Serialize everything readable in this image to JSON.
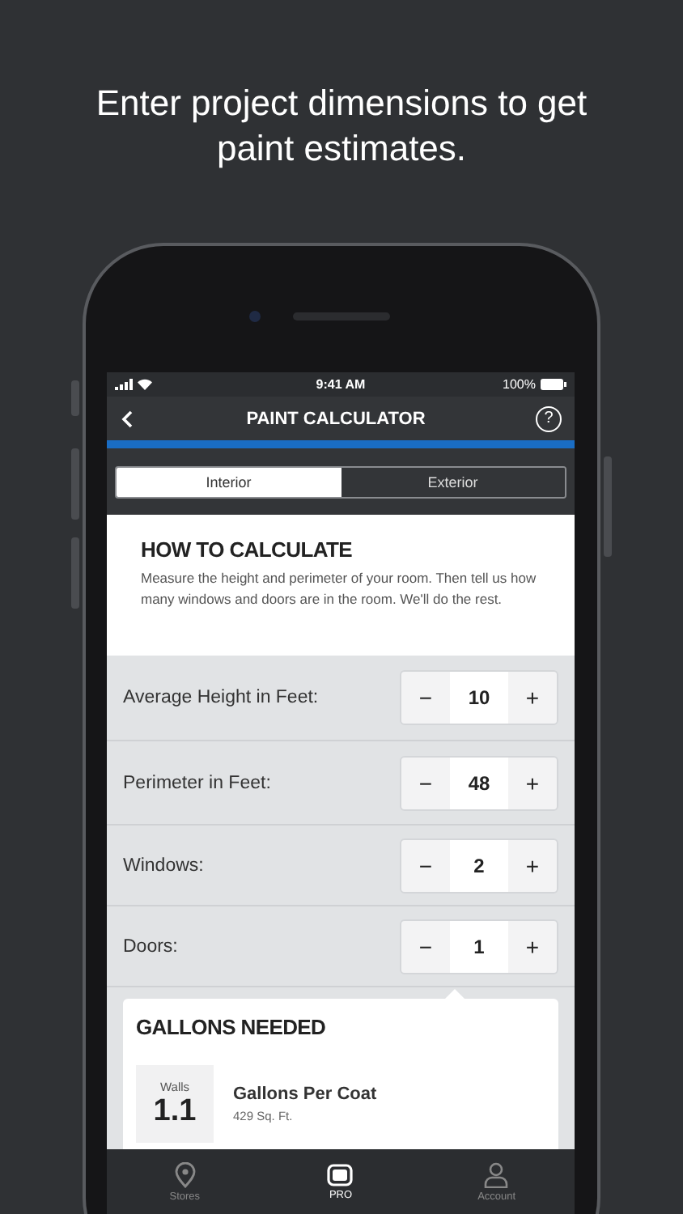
{
  "headline": "Enter project dimensions to get paint estimates.",
  "status_bar": {
    "time": "9:41 AM",
    "battery": "100%"
  },
  "nav": {
    "title": "PAINT CALCULATOR",
    "help": "?"
  },
  "tabs": [
    {
      "label": "Interior",
      "selected": true
    },
    {
      "label": "Exterior",
      "selected": false
    }
  ],
  "how_to": {
    "title": "HOW TO CALCULATE",
    "text": "Measure the height and perimeter of your room. Then tell us how many windows and doors are in the room. We'll do the rest."
  },
  "inputs": [
    {
      "label": "Average Height in Feet:",
      "value": "10",
      "decrement": "−",
      "increment": "+"
    },
    {
      "label": "Perimeter in Feet:",
      "value": "48",
      "decrement": "−",
      "increment": "+"
    },
    {
      "label": "Windows:",
      "value": "2",
      "decrement": "−",
      "increment": "+"
    },
    {
      "label": "Doors:",
      "value": "1",
      "decrement": "−",
      "increment": "+"
    }
  ],
  "result": {
    "title": "GALLONS NEEDED",
    "items": [
      {
        "label": "Walls",
        "value": "1.1",
        "title": "Gallons Per Coat",
        "subtitle": "429 Sq. Ft."
      }
    ]
  },
  "tab_bar": [
    {
      "label": "Stores",
      "selected": false
    },
    {
      "label": "PRO",
      "selected": true
    },
    {
      "label": "Account",
      "selected": false
    }
  ]
}
